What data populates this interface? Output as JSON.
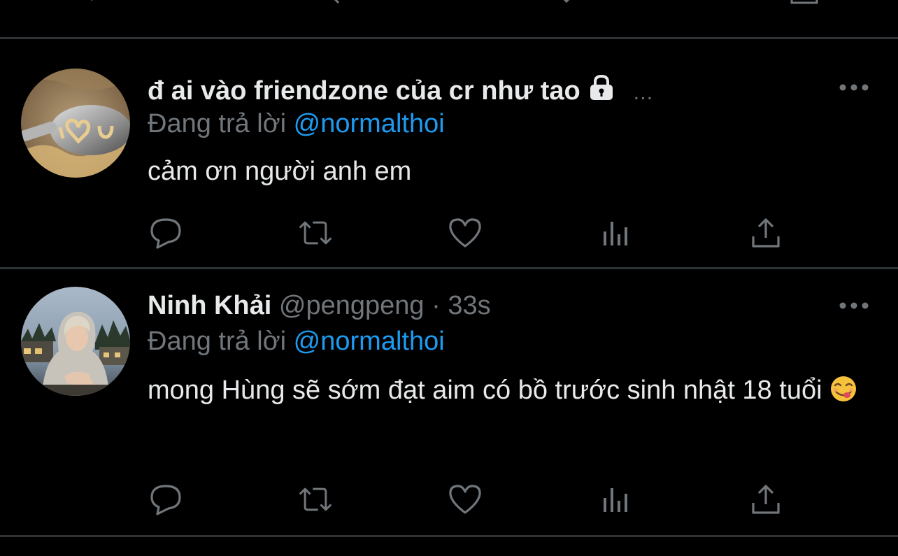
{
  "icons": {
    "reply": "reply-icon",
    "retweet": "retweet-icon",
    "like": "like-icon",
    "views": "views-icon",
    "share": "share-icon",
    "more": "more-icon",
    "lock": "lock-icon"
  },
  "colors": {
    "background": "#000000",
    "text": "#e7e9ea",
    "muted": "#71767b",
    "accent": "#1d9bf0",
    "divider": "#2f3336"
  },
  "tweets": [
    {
      "name": "đ ai vào friendzone của cr như tao",
      "handle": "…",
      "reply_prefix": "Đang trả lời",
      "reply_to": "@normalthoi",
      "text": "cảm ơn người anh em",
      "locked": true
    },
    {
      "name": "Ninh Khải",
      "handle": "@pengpeng",
      "dot": "·",
      "time": "33s",
      "reply_prefix": "Đang trả lời",
      "reply_to": "@normalthoi",
      "text": "mong Hùng sẽ sớm đạt aim có bồ trước sinh nhật 18 tuổi",
      "emoji": "face-savoring-food-emoji"
    }
  ]
}
